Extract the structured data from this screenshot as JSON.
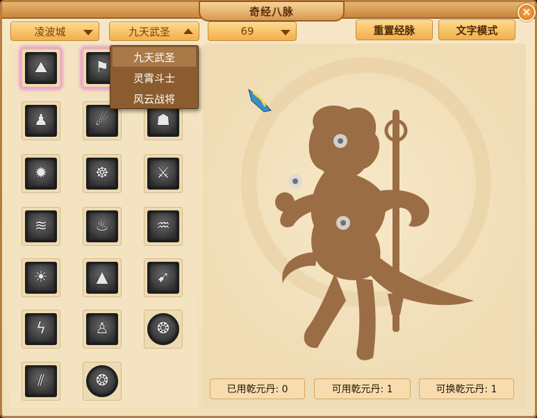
{
  "title": "奇经八脉",
  "close_label": "✕",
  "controls": {
    "school": "凌波城",
    "role": "九天武圣",
    "level": "69",
    "reset_label": "重置经脉",
    "text_mode_label": "文字模式"
  },
  "role_menu": {
    "items": [
      "九天武圣",
      "灵霄斗士",
      "风云战将"
    ],
    "selected": "九天武圣"
  },
  "skills": [
    {
      "icon": "mountain-strike-icon",
      "glyph": "⛰"
    },
    {
      "icon": "banner-icon",
      "glyph": "⚑"
    },
    {
      "icon": "vortex-icon",
      "glyph": "✺"
    },
    {
      "icon": "figure-icon",
      "glyph": "♟"
    },
    {
      "icon": "flame-orbs-icon",
      "glyph": "☄"
    },
    {
      "icon": "warrior-roar-icon",
      "glyph": "☗"
    },
    {
      "icon": "radiant-burst-icon",
      "glyph": "✹"
    },
    {
      "icon": "meditation-icon",
      "glyph": "☸"
    },
    {
      "icon": "crossed-blades-icon",
      "glyph": "⚔"
    },
    {
      "icon": "wind-slash-icon",
      "glyph": "≋"
    },
    {
      "icon": "smoke-spirit-icon",
      "glyph": "♨"
    },
    {
      "icon": "heat-waves-icon",
      "glyph": "♒"
    },
    {
      "icon": "sun-figure-icon",
      "glyph": "☀"
    },
    {
      "icon": "peak-icon",
      "glyph": "▲"
    },
    {
      "icon": "triple-arrow-icon",
      "glyph": "➹"
    },
    {
      "icon": "lightning-icon",
      "glyph": "ϟ"
    },
    {
      "icon": "seated-figure-icon",
      "glyph": "♙"
    },
    {
      "icon": "dragon-medallion-icon",
      "glyph": "❂"
    },
    {
      "icon": "claw-slash-icon",
      "glyph": "⫽"
    },
    {
      "icon": "dragon-medallion-icon-2",
      "glyph": "❂"
    }
  ],
  "stats": {
    "used": "已用乾元丹: 0",
    "available": "可用乾元丹: 1",
    "exchangeable": "可换乾元丹: 1"
  },
  "colors": {
    "frame": "#b77d3c",
    "panel": "#f3e3c1",
    "silhouette": "#9a6d44",
    "button": "#f0b04c"
  }
}
